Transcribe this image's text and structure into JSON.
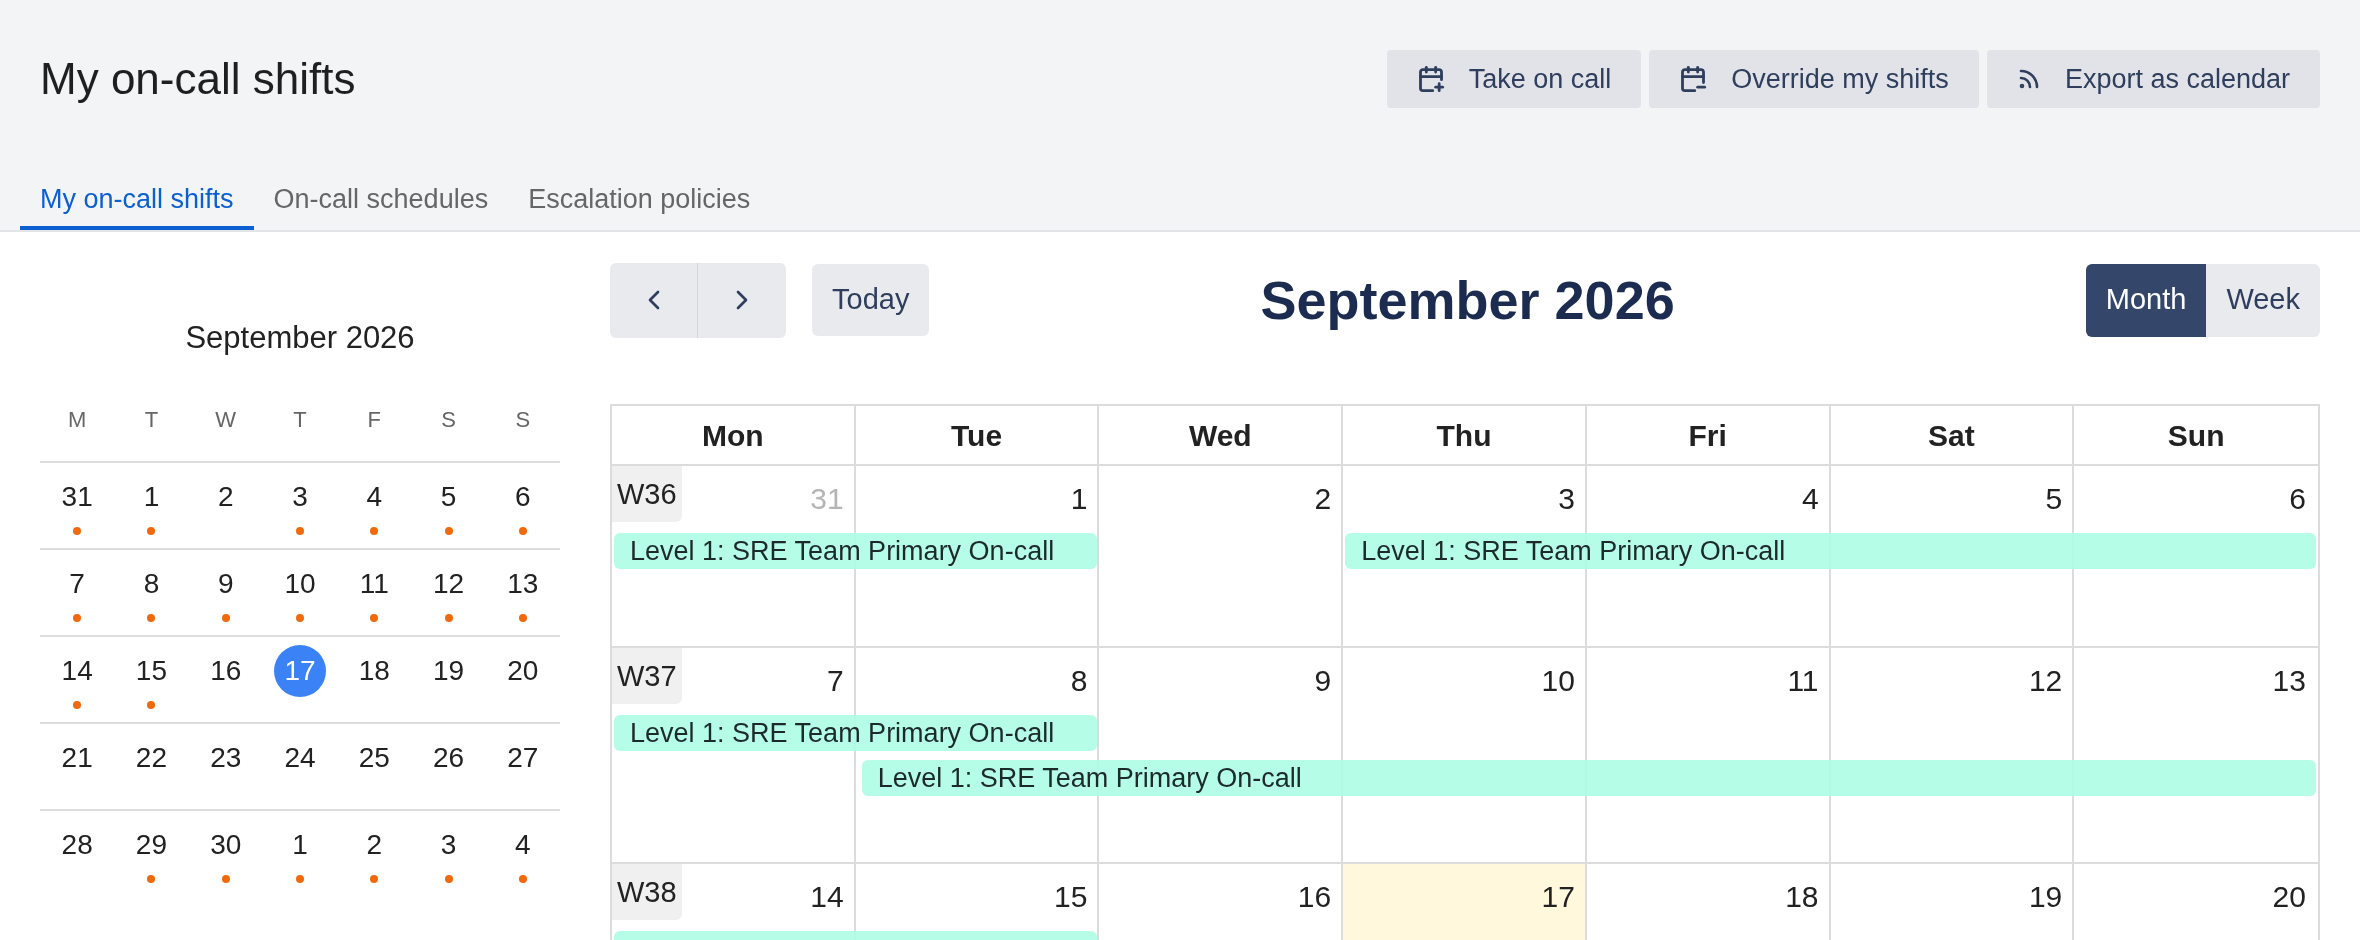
{
  "header": {
    "title": "My on-call shifts",
    "actions": [
      {
        "label": "Take on call"
      },
      {
        "label": "Override my shifts"
      },
      {
        "label": "Export as calendar"
      }
    ]
  },
  "tabs": [
    {
      "label": "My on-call shifts",
      "selected": true
    },
    {
      "label": "On-call schedules",
      "selected": false
    },
    {
      "label": "Escalation policies",
      "selected": false
    }
  ],
  "mini_calendar": {
    "title": "September 2026",
    "weekdays": [
      "M",
      "T",
      "W",
      "T",
      "F",
      "S",
      "S"
    ],
    "weeks": [
      [
        {
          "day": "31",
          "dot": true,
          "selected": false
        },
        {
          "day": "1",
          "dot": true,
          "selected": false
        },
        {
          "day": "2",
          "dot": false,
          "selected": false
        },
        {
          "day": "3",
          "dot": true,
          "selected": false
        },
        {
          "day": "4",
          "dot": true,
          "selected": false
        },
        {
          "day": "5",
          "dot": true,
          "selected": false
        },
        {
          "day": "6",
          "dot": true,
          "selected": false
        }
      ],
      [
        {
          "day": "7",
          "dot": true,
          "selected": false
        },
        {
          "day": "8",
          "dot": true,
          "selected": false
        },
        {
          "day": "9",
          "dot": true,
          "selected": false
        },
        {
          "day": "10",
          "dot": true,
          "selected": false
        },
        {
          "day": "11",
          "dot": true,
          "selected": false
        },
        {
          "day": "12",
          "dot": true,
          "selected": false
        },
        {
          "day": "13",
          "dot": true,
          "selected": false
        }
      ],
      [
        {
          "day": "14",
          "dot": true,
          "selected": false
        },
        {
          "day": "15",
          "dot": true,
          "selected": false
        },
        {
          "day": "16",
          "dot": false,
          "selected": false
        },
        {
          "day": "17",
          "dot": false,
          "selected": true
        },
        {
          "day": "18",
          "dot": false,
          "selected": false
        },
        {
          "day": "19",
          "dot": false,
          "selected": false
        },
        {
          "day": "20",
          "dot": false,
          "selected": false
        }
      ],
      [
        {
          "day": "21",
          "dot": false,
          "selected": false
        },
        {
          "day": "22",
          "dot": false,
          "selected": false
        },
        {
          "day": "23",
          "dot": false,
          "selected": false
        },
        {
          "day": "24",
          "dot": false,
          "selected": false
        },
        {
          "day": "25",
          "dot": false,
          "selected": false
        },
        {
          "day": "26",
          "dot": false,
          "selected": false
        },
        {
          "day": "27",
          "dot": false,
          "selected": false
        }
      ],
      [
        {
          "day": "28",
          "dot": false,
          "selected": false
        },
        {
          "day": "29",
          "dot": true,
          "selected": false
        },
        {
          "day": "30",
          "dot": true,
          "selected": false
        },
        {
          "day": "1",
          "dot": true,
          "selected": false
        },
        {
          "day": "2",
          "dot": true,
          "selected": false
        },
        {
          "day": "3",
          "dot": true,
          "selected": false
        },
        {
          "day": "4",
          "dot": true,
          "selected": false
        }
      ]
    ]
  },
  "calendar": {
    "title": "September 2026",
    "today_button": "Today",
    "views": [
      {
        "label": "Month",
        "selected": true
      },
      {
        "label": "Week",
        "selected": false
      }
    ],
    "columns": [
      "Mon",
      "Tue",
      "Wed",
      "Thu",
      "Fri",
      "Sat",
      "Sun"
    ],
    "weeks": [
      {
        "label": "W36",
        "days": [
          {
            "day": "31",
            "outside": true,
            "today": false
          },
          {
            "day": "1",
            "outside": false,
            "today": false
          },
          {
            "day": "2",
            "outside": false,
            "today": false
          },
          {
            "day": "3",
            "outside": false,
            "today": false
          },
          {
            "day": "4",
            "outside": false,
            "today": false
          },
          {
            "day": "5",
            "outside": false,
            "today": false
          },
          {
            "day": "6",
            "outside": false,
            "today": false
          }
        ],
        "lanes": [
          [
            {
              "label": "Level 1: SRE Team Primary On-call"
            },
            {
              "label": "Level 1: SRE Team Primary On-call"
            }
          ]
        ]
      },
      {
        "label": "W37",
        "days": [
          {
            "day": "7",
            "outside": false,
            "today": false
          },
          {
            "day": "8",
            "outside": false,
            "today": false
          },
          {
            "day": "9",
            "outside": false,
            "today": false
          },
          {
            "day": "10",
            "outside": false,
            "today": false
          },
          {
            "day": "11",
            "outside": false,
            "today": false
          },
          {
            "day": "12",
            "outside": false,
            "today": false
          },
          {
            "day": "13",
            "outside": false,
            "today": false
          }
        ],
        "lanes": [
          [
            {
              "label": "Level 1: SRE Team Primary On-call"
            }
          ],
          [
            {
              "label": "Level 1: SRE Team Primary On-call"
            }
          ]
        ]
      },
      {
        "label": "W38",
        "days": [
          {
            "day": "14",
            "outside": false,
            "today": false
          },
          {
            "day": "15",
            "outside": false,
            "today": false
          },
          {
            "day": "16",
            "outside": false,
            "today": false
          },
          {
            "day": "17",
            "outside": false,
            "today": true
          },
          {
            "day": "18",
            "outside": false,
            "today": false
          },
          {
            "day": "19",
            "outside": false,
            "today": false
          },
          {
            "day": "20",
            "outside": false,
            "today": false
          }
        ]
      }
    ]
  }
}
